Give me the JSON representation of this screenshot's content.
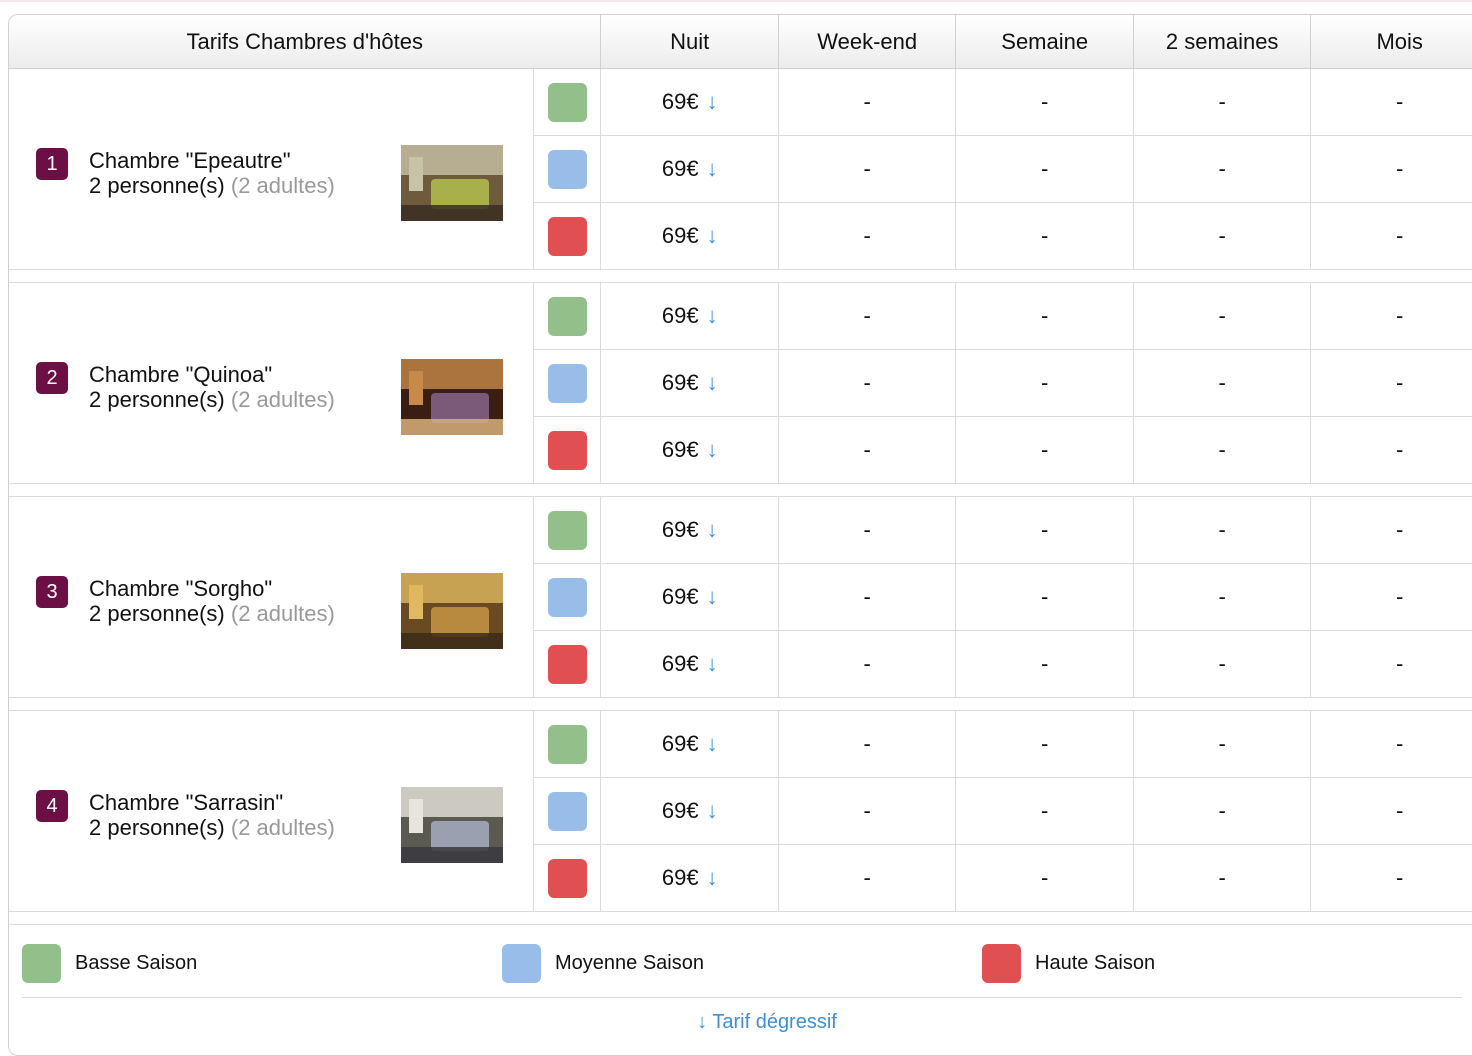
{
  "colors": {
    "basse": "#93c08a",
    "moyenne": "#99bde9",
    "haute": "#e04f51",
    "badge": "#6b0f45",
    "link": "#3d8fd6"
  },
  "header": {
    "title": "Tarifs Chambres d'hôtes",
    "cols": [
      "Nuit",
      "Week-end",
      "Semaine",
      "2 semaines",
      "Mois"
    ]
  },
  "rooms": [
    {
      "num": "1",
      "name": "Chambre \"Epeautre\"",
      "capacity": "2 personne(s)",
      "adults": "(2 adultes)",
      "rates": [
        {
          "nuit": "69€",
          "arrow": "↓",
          "weekend": "-",
          "semaine": "-",
          "deux_semaines": "-",
          "mois": "-"
        },
        {
          "nuit": "69€",
          "arrow": "↓",
          "weekend": "-",
          "semaine": "-",
          "deux_semaines": "-",
          "mois": "-"
        },
        {
          "nuit": "69€",
          "arrow": "↓",
          "weekend": "-",
          "semaine": "-",
          "deux_semaines": "-",
          "mois": "-"
        }
      ]
    },
    {
      "num": "2",
      "name": "Chambre \"Quinoa\"",
      "capacity": "2 personne(s)",
      "adults": "(2 adultes)",
      "rates": [
        {
          "nuit": "69€",
          "arrow": "↓",
          "weekend": "-",
          "semaine": "-",
          "deux_semaines": "-",
          "mois": "-"
        },
        {
          "nuit": "69€",
          "arrow": "↓",
          "weekend": "-",
          "semaine": "-",
          "deux_semaines": "-",
          "mois": "-"
        },
        {
          "nuit": "69€",
          "arrow": "↓",
          "weekend": "-",
          "semaine": "-",
          "deux_semaines": "-",
          "mois": "-"
        }
      ]
    },
    {
      "num": "3",
      "name": "Chambre \"Sorgho\"",
      "capacity": "2 personne(s)",
      "adults": "(2 adultes)",
      "rates": [
        {
          "nuit": "69€",
          "arrow": "↓",
          "weekend": "-",
          "semaine": "-",
          "deux_semaines": "-",
          "mois": "-"
        },
        {
          "nuit": "69€",
          "arrow": "↓",
          "weekend": "-",
          "semaine": "-",
          "deux_semaines": "-",
          "mois": "-"
        },
        {
          "nuit": "69€",
          "arrow": "↓",
          "weekend": "-",
          "semaine": "-",
          "deux_semaines": "-",
          "mois": "-"
        }
      ]
    },
    {
      "num": "4",
      "name": "Chambre \"Sarrasin\"",
      "capacity": "2 personne(s)",
      "adults": "(2 adultes)",
      "rates": [
        {
          "nuit": "69€",
          "arrow": "↓",
          "weekend": "-",
          "semaine": "-",
          "deux_semaines": "-",
          "mois": "-"
        },
        {
          "nuit": "69€",
          "arrow": "↓",
          "weekend": "-",
          "semaine": "-",
          "deux_semaines": "-",
          "mois": "-"
        },
        {
          "nuit": "69€",
          "arrow": "↓",
          "weekend": "-",
          "semaine": "-",
          "deux_semaines": "-",
          "mois": "-"
        }
      ]
    }
  ],
  "legend": {
    "basse": "Basse Saison",
    "moyenne": "Moyenne Saison",
    "haute": "Haute Saison",
    "degressif": "↓ Tarif dégressif"
  }
}
